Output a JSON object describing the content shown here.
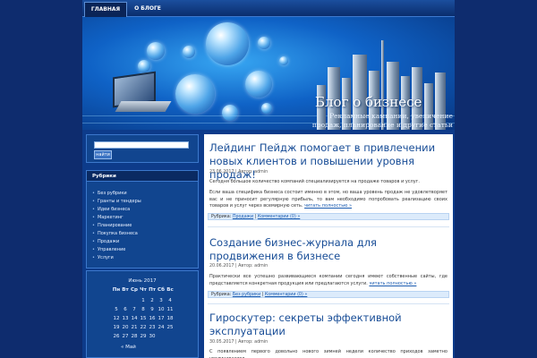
{
  "nav": {
    "tabs": [
      {
        "label": "ГЛАВНАЯ"
      },
      {
        "label": "О БЛОГЕ"
      }
    ]
  },
  "header": {
    "title": "Блог о бизнесе",
    "description": "Рекламные кампании, увеличение продаж, планирование и другие статьи о"
  },
  "search": {
    "value": "",
    "button_label": "найти"
  },
  "categories": {
    "title": "Рубрики",
    "items": [
      {
        "label": "Без рубрики"
      },
      {
        "label": "Гранты и тендеры"
      },
      {
        "label": "Идеи бизнеса"
      },
      {
        "label": "Маркетинг"
      },
      {
        "label": "Планирование"
      },
      {
        "label": "Покупка бизнеса"
      },
      {
        "label": "Продажи"
      },
      {
        "label": "Управление"
      },
      {
        "label": "Услуги"
      }
    ]
  },
  "calendar": {
    "caption": "Июнь 2017",
    "weekdays": [
      "Пн",
      "Вт",
      "Ср",
      "Чт",
      "Пт",
      "Сб",
      "Вс"
    ],
    "weeks": [
      [
        "",
        "",
        "",
        "1",
        "2",
        "3",
        "4"
      ],
      [
        "5",
        "6",
        "7",
        "8",
        "9",
        "10",
        "11"
      ],
      [
        "12",
        "13",
        "14",
        "15",
        "16",
        "17",
        "18"
      ],
      [
        "19",
        "20",
        "21",
        "22",
        "23",
        "24",
        "25"
      ],
      [
        "26",
        "27",
        "28",
        "29",
        "30",
        "",
        ""
      ]
    ],
    "prev_label": "« Май"
  },
  "posts": [
    {
      "title": "Лейдинг Пейдж помогает в привлечении новых клиентов и повышении уровня продаж!",
      "meta": "23.06.2017 | Автор: admin",
      "paragraph1": "Сегодня большое количество компаний специализируется на продаже товаров и услуг.",
      "paragraph2": "Если ваша специфика бизнеса состоит именно в этом, но ваша уровень продаж не удовлетворяет вас и не приносит регулярную прибыль, то вам необходимо попробовать реализацию своих товаров и услуг через всемирную сеть.",
      "more_label": "читать полностью »",
      "rubric_label": "Рубрика:",
      "rubric_link": "Продажи",
      "comments_label": "Комментарии (0) »"
    },
    {
      "title": "Создание бизнес-журнала для продвижения в бизнесе",
      "meta": "20.06.2017 | Автор: admin",
      "paragraph1": "Практически все успешно развивающиеся компании сегодня имеют собственные сайты, где представляется конкретная продукция или предлагаются услуги.",
      "more_label": "читать полностью »",
      "rubric_label": "Рубрика:",
      "rubric_link": "Без рубрики",
      "comments_label": "Комментарии (0) »"
    },
    {
      "title": "Гироскутер: секреты эффективной эксплуатации",
      "meta": "30.05.2017 | Автор: admin",
      "paragraph1": "С появлением первого довольно нового зимней недели количество приходов заметно увеличивается"
    }
  ]
}
